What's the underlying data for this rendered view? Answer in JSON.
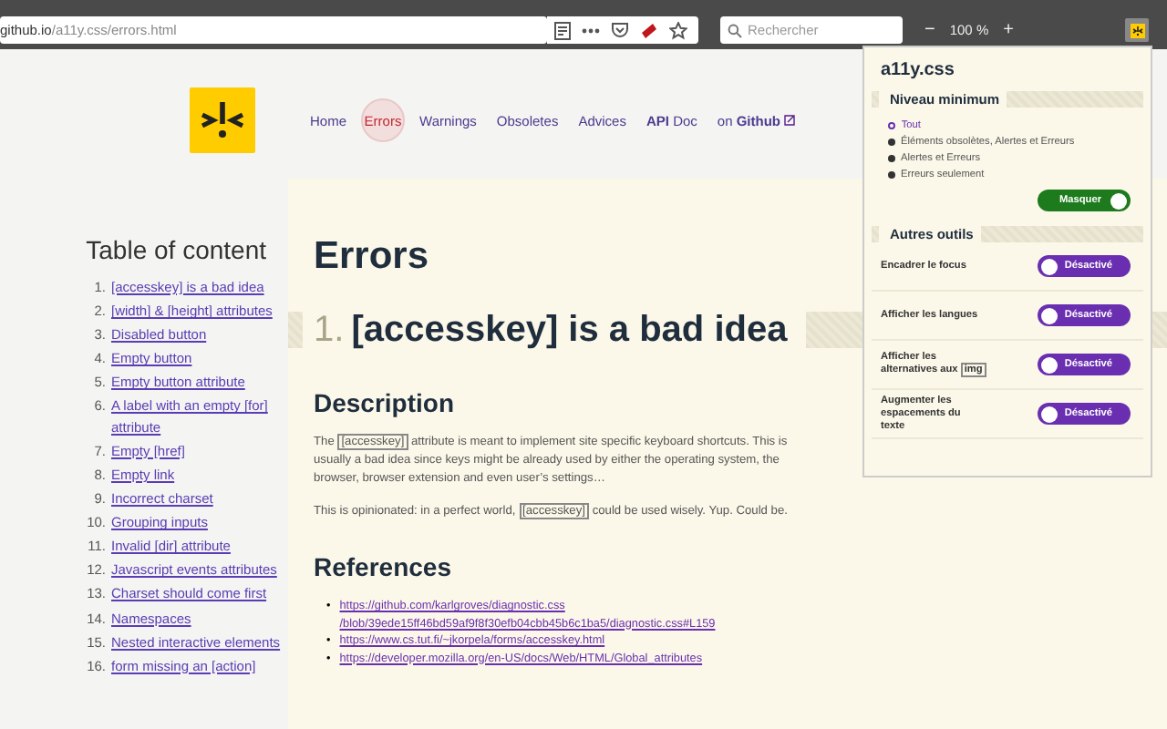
{
  "browser": {
    "url_host": "github.io",
    "url_path": "/a11y.css/errors.html",
    "search": {
      "placeholder": "Rechercher"
    },
    "zoom_out": "−",
    "zoom": "100 %",
    "zoom_in": "+"
  },
  "nav": [
    {
      "label": "Home",
      "selected": false
    },
    {
      "label": "Errors",
      "selected": true
    },
    {
      "label": "Warnings",
      "selected": false
    },
    {
      "label": "Obsoletes",
      "selected": false
    },
    {
      "label": "Advices",
      "selected": false
    },
    {
      "label": "**API** Doc",
      "selected": false
    },
    {
      "label": "on **Github**",
      "selected": false,
      "external": true
    }
  ],
  "toc": {
    "title": "Table of content",
    "items": [
      {
        "number": "1.",
        "label": "[accesskey] is a bad idea"
      },
      {
        "number": "2.",
        "label": "[width] & [height] attributes"
      },
      {
        "number": "3.",
        "label": "Disabled button"
      },
      {
        "number": "4.",
        "label": "Empty button"
      },
      {
        "number": "5.",
        "label": "Empty button attribute"
      },
      {
        "number": "6.",
        "label": "A label with an empty [for] attribute"
      },
      {
        "number": "7.",
        "label": "Empty [href]"
      },
      {
        "number": "8.",
        "label": "Empty link"
      },
      {
        "number": "9.",
        "label": "Incorrect charset"
      },
      {
        "number": "10.",
        "label": "Grouping inputs"
      },
      {
        "number": "11.",
        "label": "Invalid [dir] attribute"
      },
      {
        "number": "12.",
        "label": "Javascript events attributes"
      },
      {
        "number": "13.",
        "label": "Charset should come first"
      },
      {
        "number": "14.",
        "label": "Namespaces"
      },
      {
        "number": "15.",
        "label": "Nested interactive elements"
      },
      {
        "number": "16.",
        "label": "form missing an [action]"
      }
    ]
  },
  "content": {
    "title": "Errors",
    "section": {
      "number": "1.",
      "title": "[accesskey] is a bad idea"
    },
    "description_heading": "Description",
    "paragraphs": [
      [
        {
          "text": "The ",
          "code": false
        },
        {
          "text": "[accesskey]",
          "code": true
        },
        {
          "text": " attribute is meant to implement site specific keyboard shortcuts. This is usually a bad idea since keys might be already used by either the operating system, the browser, browser extension and even user’s settings…",
          "code": false
        }
      ],
      [
        {
          "text": "This is opinionated: in a perfect world, ",
          "code": false
        },
        {
          "text": "[accesskey]",
          "code": true
        },
        {
          "text": " could be used wisely. Yup. Could be.",
          "code": false
        }
      ]
    ],
    "references_heading": "References",
    "references": [
      {
        "bullet": "•",
        "url": "https://github.com/karlgroves/diagnostic.css /blob/39ede15ff46bd59af9f8f30efb04cbb45b6c1ba5/diagnostic.css#L159"
      },
      {
        "bullet": "•",
        "url": "https://www.cs.tut.fi/~jkorpela/forms/accesskey.html"
      },
      {
        "bullet": "•",
        "url": "https://developer.mozilla.org/en-US/docs/Web/HTML/Global_attributes"
      }
    ]
  },
  "popup": {
    "title": "a11y.css",
    "level_heading": "Niveau minimum",
    "levels": [
      {
        "label": "Tout",
        "selected": true
      },
      {
        "label": "Éléments obsolètes, Alertes et Erreurs",
        "selected": false
      },
      {
        "label": "Alertes et Erreurs",
        "selected": false
      },
      {
        "label": "Erreurs seulement",
        "selected": false
      }
    ],
    "hide_toggle": {
      "label": "Masquer",
      "on": true
    },
    "tools_heading": "Autres outils",
    "tools": [
      {
        "label": [
          {
            "text": "Encadrer le focus",
            "code": false
          }
        ],
        "toggle": "Désactivé",
        "on": false
      },
      {
        "label": [
          {
            "text": "Afficher les langues",
            "code": false
          }
        ],
        "toggle": "Désactivé",
        "on": false
      },
      {
        "label": [
          {
            "text": "Afficher les alternatives aux ",
            "code": false
          },
          {
            "text": "img",
            "code": true
          }
        ],
        "toggle": "Désactivé",
        "on": false
      },
      {
        "label": [
          {
            "text": "Augmenter les espacements du texte",
            "code": false
          }
        ],
        "toggle": "Désactivé",
        "on": false
      }
    ]
  }
}
